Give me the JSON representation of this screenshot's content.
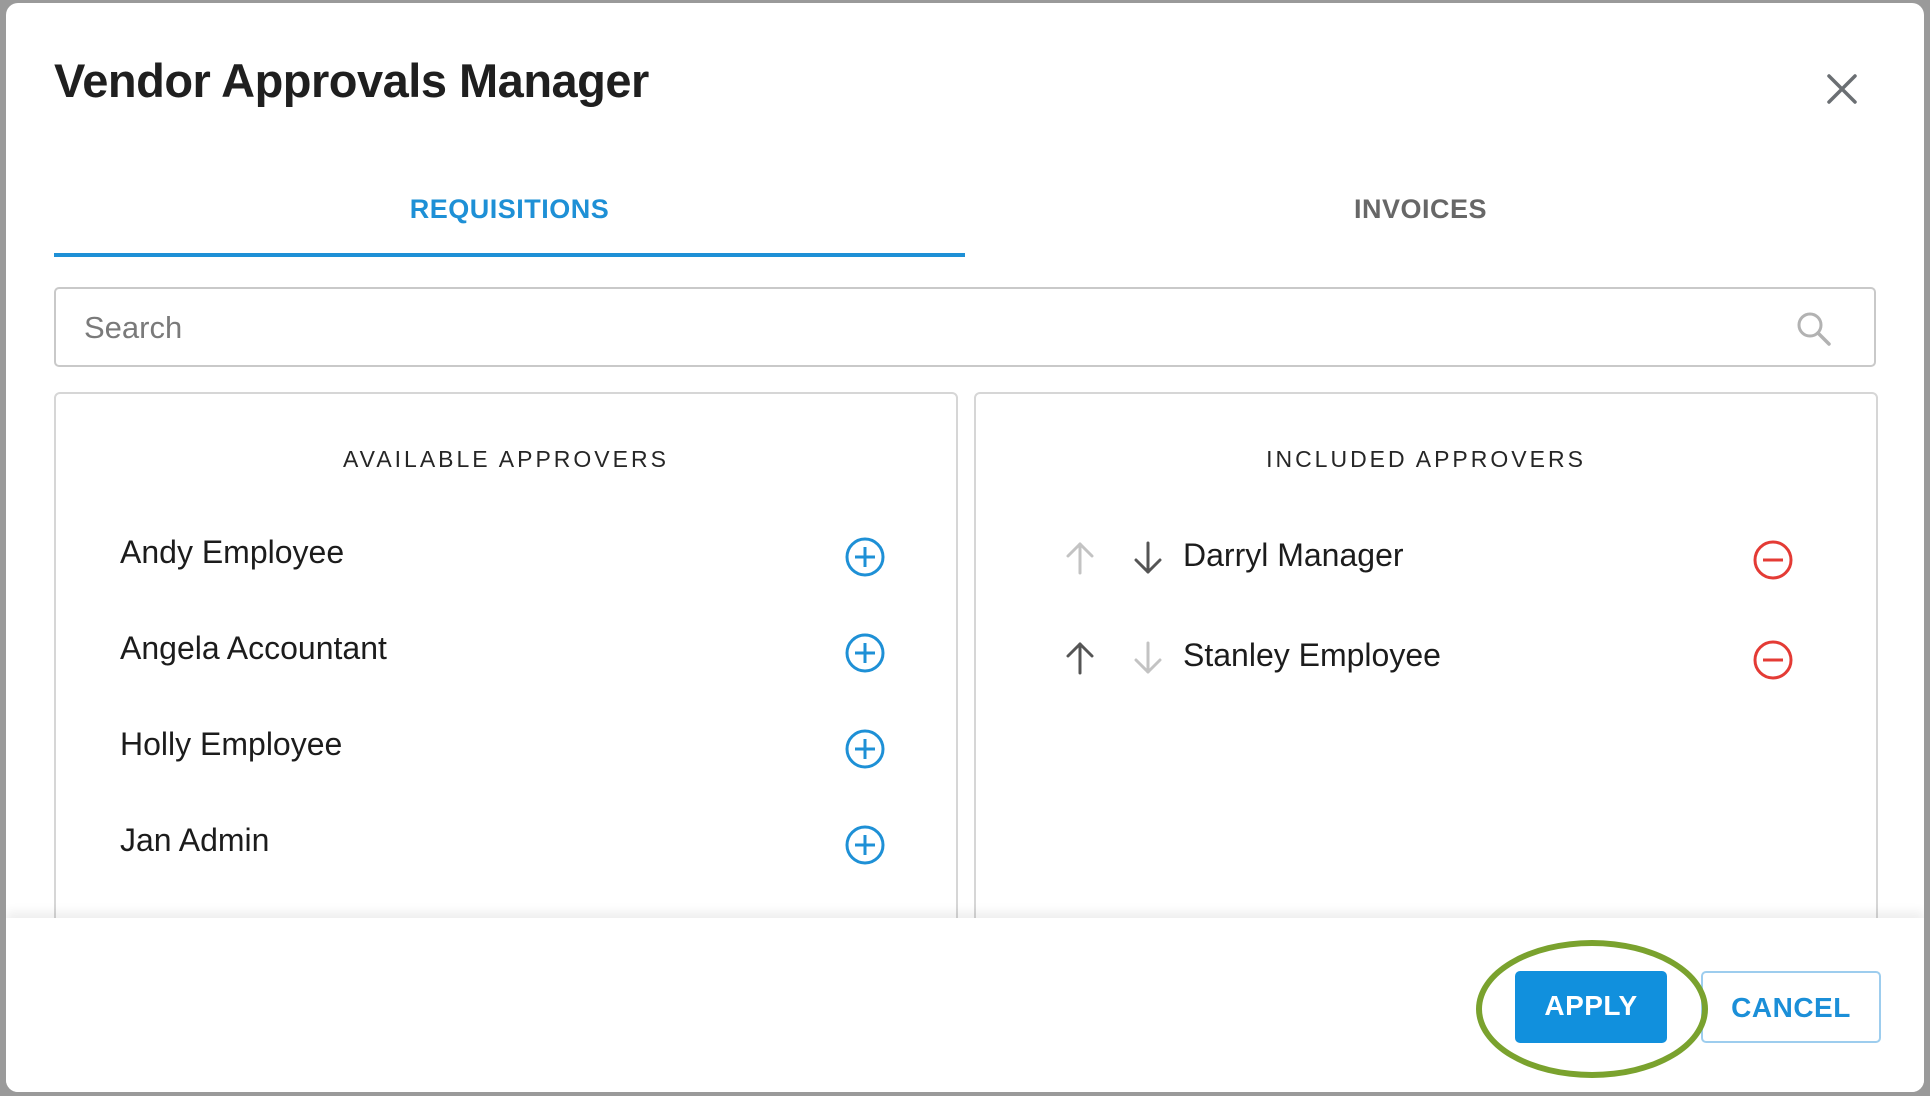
{
  "dialog": {
    "title": "Vendor Approvals Manager"
  },
  "tabs": [
    {
      "label": "REQUISITIONS",
      "active": true
    },
    {
      "label": "INVOICES",
      "active": false
    }
  ],
  "search": {
    "placeholder": "Search",
    "value": ""
  },
  "available": {
    "title": "AVAILABLE APPROVERS",
    "items": [
      {
        "name": "Andy Employee"
      },
      {
        "name": "Angela Accountant"
      },
      {
        "name": "Holly Employee"
      },
      {
        "name": "Jan Admin"
      }
    ]
  },
  "included": {
    "title": "INCLUDED APPROVERS",
    "items": [
      {
        "name": "Darryl Manager",
        "up_enabled": false,
        "down_enabled": true
      },
      {
        "name": "Stanley Employee",
        "up_enabled": true,
        "down_enabled": false
      }
    ]
  },
  "footer": {
    "apply_label": "APPLY",
    "cancel_label": "CANCEL"
  },
  "colors": {
    "accent": "#1e90d6",
    "remove": "#e43b35",
    "highlight": "#7aa22e"
  }
}
